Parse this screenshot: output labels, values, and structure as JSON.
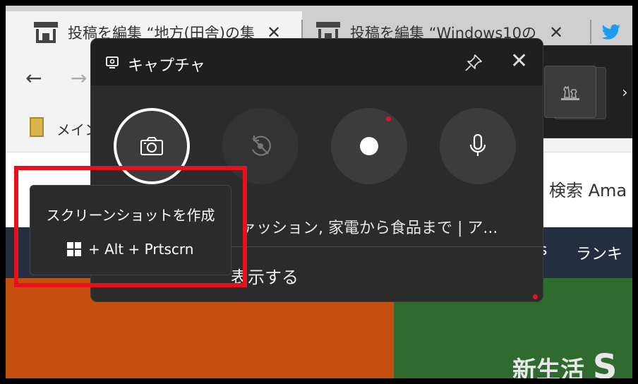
{
  "browser": {
    "tabs": [
      {
        "title": "投稿を編集 “地方(田舎)の集",
        "close": "✕"
      },
      {
        "title": "投稿を編集 “Windows10の",
        "close": "✕"
      }
    ],
    "bookmark_label": "メイン"
  },
  "page": {
    "search_text": "検索 Ama",
    "nav_items": [
      "s",
      "ランキ"
    ],
    "banner_text": "新生活",
    "banner_letter": "S"
  },
  "capture_panel": {
    "title": "キャプチャ",
    "close_glyph": "✕",
    "link_text": "ァッション, 家電から食品まで | ア...",
    "show_text": "表示する"
  },
  "tooltip": {
    "title": "スクリーンショットを作成",
    "shortcut": "+ Alt + Prtscrn"
  },
  "widget": {
    "chevron": "›"
  },
  "colors": {
    "highlight": "#e8101a",
    "record_dot": "#e81123",
    "panel_bg": "#2b2b2b",
    "header_bg": "#1f1f1f",
    "twitter": "#1d9bf0"
  },
  "icons": [
    "store-favicon",
    "twitter-icon",
    "back-arrow-icon",
    "forward-arrow-icon",
    "bookmark-icon",
    "monitor-capture-icon",
    "pin-icon",
    "camera-icon",
    "no-replay-icon",
    "record-dot-icon",
    "microphone-icon",
    "windows-logo-icon",
    "chess-widget-icon",
    "chevron-right-icon"
  ]
}
